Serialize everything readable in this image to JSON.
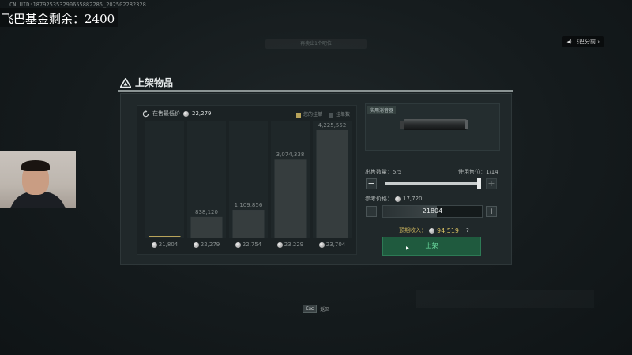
{
  "overlay": {
    "uid_text": "CN UID:187925353290655882285_202502282328",
    "fund_text": "飞巴基金剩余：2400",
    "streamer_tag": "飞巴分前",
    "top_hint": "再卖出1个吧位"
  },
  "dialog": {
    "title": "上架物品",
    "chart": {
      "lowest_label": "在售最低价",
      "lowest_price": "22,279",
      "legend_mine": "您的挂单",
      "legend_others": "挂单数"
    },
    "item": {
      "name_tag": "实用消音器"
    },
    "sell_qty_label": "出售数量：",
    "sell_qty_value": "5/5",
    "slots_label": "使用售位：",
    "slots_value": "1/14",
    "minus": "−",
    "plus": "+",
    "ref_price_label": "参考价格：",
    "ref_price_value": "17,720",
    "price_input": "21804",
    "income_label": "预期收入：",
    "income_value": "94,519",
    "help": "?",
    "list_button": "上架"
  },
  "footer": {
    "esc_key": "Esc",
    "esc_label": "返回"
  },
  "colors": {
    "accent_gold": "#b8a35a",
    "list_button_bg": "#1f5a3e",
    "list_button_text": "#6de0a2"
  },
  "chart_data": {
    "type": "bar",
    "categories": [
      "21,804",
      "22,279",
      "22,754",
      "23,229",
      "23,704"
    ],
    "values": [
      0,
      838120,
      1109856,
      3074338,
      4225552
    ],
    "value_labels": [
      "",
      "838,120",
      "1,109,856",
      "3,074,338",
      "4,225,552"
    ],
    "ylim": [
      0,
      4225552
    ],
    "series": [
      {
        "name": "您的挂单",
        "values": [
          1,
          0,
          0,
          0,
          0
        ]
      },
      {
        "name": "挂单数",
        "values": [
          0,
          838120,
          1109856,
          3074338,
          4225552
        ]
      }
    ]
  }
}
